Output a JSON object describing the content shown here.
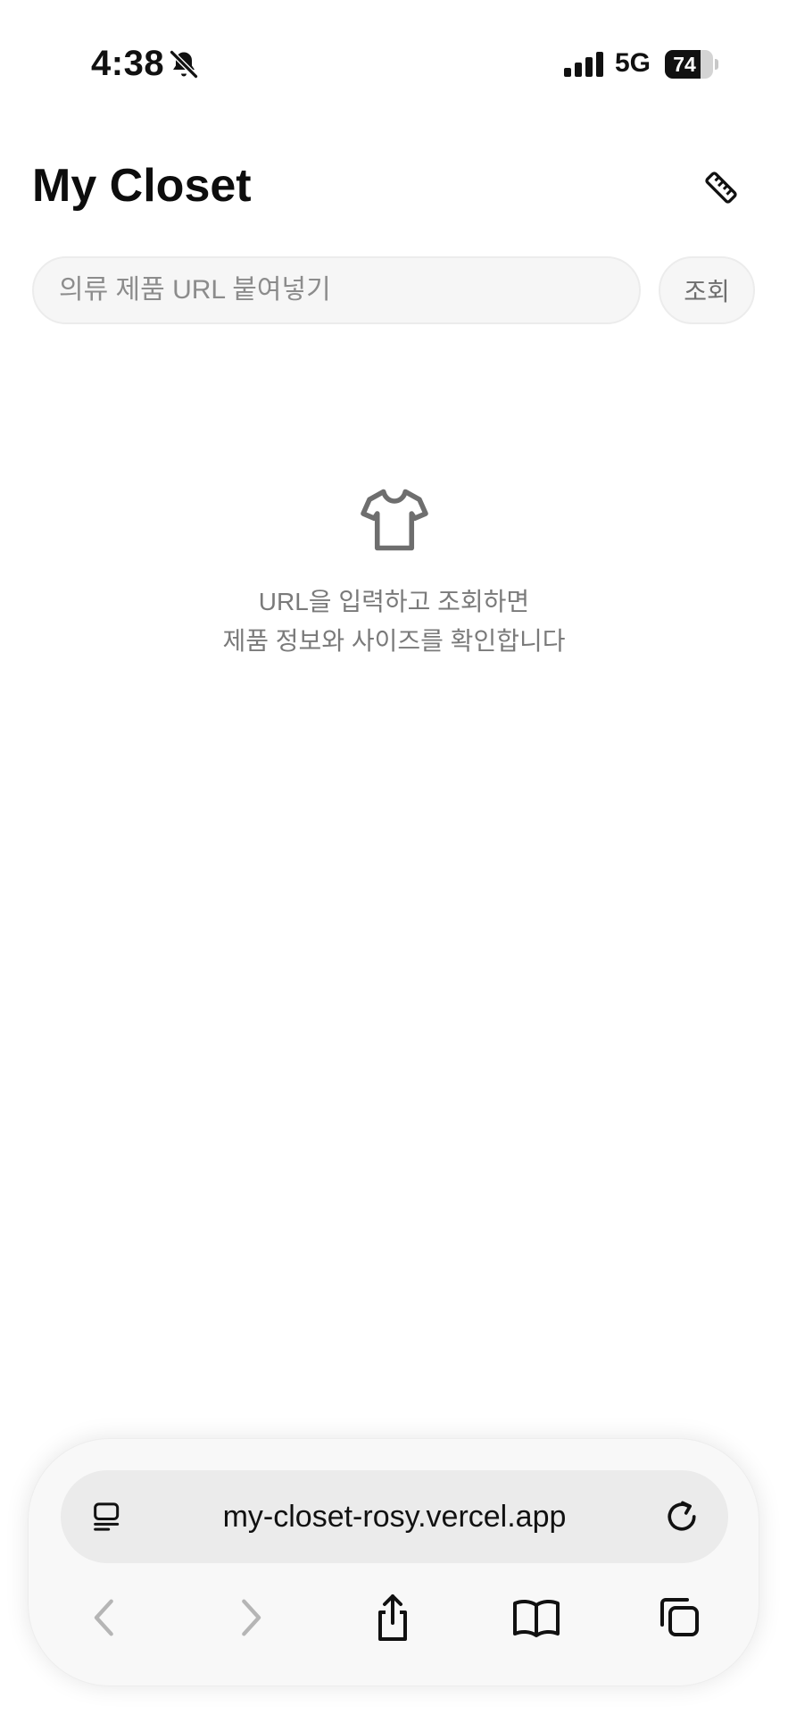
{
  "status_bar": {
    "time": "4:38",
    "network": "5G",
    "battery_level": "74",
    "battery_percent": 74,
    "icons": [
      "bell-slash-icon",
      "signal-bars-icon",
      "battery-icon"
    ]
  },
  "header": {
    "title": "My Closet",
    "ruler_icon": "ruler-icon"
  },
  "search": {
    "placeholder": "의류 제품 URL 붙여넣기",
    "value": "",
    "button_label": "조회"
  },
  "empty_state": {
    "icon": "tshirt-icon",
    "line1": "URL을 입력하고 조회하면",
    "line2": "제품 정보와 사이즈를 확인합니다"
  },
  "browser": {
    "url": "my-closet-rosy.vercel.app",
    "icons": [
      "reader-mode-icon",
      "reload-icon",
      "back-icon",
      "forward-icon",
      "share-icon",
      "bookmarks-icon",
      "tabs-icon"
    ],
    "back_enabled": false,
    "forward_enabled": false
  },
  "colors": {
    "text_primary": "#0d0d0d",
    "text_muted": "#7a7a7a",
    "input_bg": "#f6f6f6",
    "input_border": "#ececec",
    "toolbar_bg": "#f8f8f8",
    "address_bg": "#ebebeb",
    "disabled_icon": "#b5b5b5"
  }
}
